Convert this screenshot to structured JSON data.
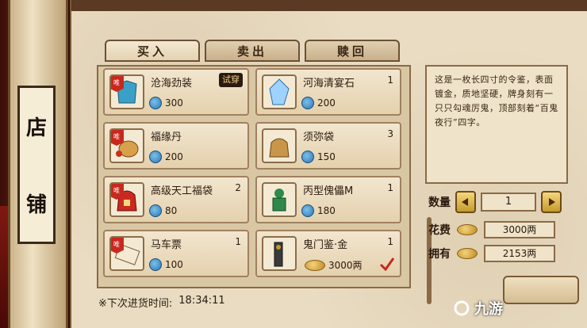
{
  "shop_sign": [
    "店",
    "铺"
  ],
  "tabs": [
    {
      "label": "买入",
      "active": true
    },
    {
      "label": "卖出",
      "active": false
    },
    {
      "label": "赎回",
      "active": false
    }
  ],
  "items": [
    {
      "name": "沧海劲装",
      "count": "",
      "price": "300",
      "currency": "blue-coin",
      "badge": "试穿",
      "ribbon": "唯"
    },
    {
      "name": "河海清宴石",
      "count": "1",
      "price": "200",
      "currency": "blue-coin",
      "badge": "",
      "ribbon": ""
    },
    {
      "name": "福缘丹",
      "count": "",
      "price": "200",
      "currency": "blue-coin",
      "badge": "",
      "ribbon": "唯"
    },
    {
      "name": "须弥袋",
      "count": "3",
      "price": "150",
      "currency": "blue-coin",
      "badge": "",
      "ribbon": ""
    },
    {
      "name": "高级天工福袋",
      "count": "2",
      "price": "80",
      "currency": "blue-coin",
      "badge": "",
      "ribbon": "唯"
    },
    {
      "name": "丙型傀儡M",
      "count": "1",
      "price": "180",
      "currency": "blue-coin",
      "badge": "",
      "ribbon": ""
    },
    {
      "name": "马车票",
      "count": "1",
      "price": "100",
      "currency": "blue-coin",
      "badge": "",
      "ribbon": "唯"
    },
    {
      "name": "鬼门鉴·金",
      "count": "1",
      "price": "3000两",
      "currency": "gold-ingot",
      "badge": "",
      "ribbon": "",
      "selected": true
    }
  ],
  "restock": {
    "label": "※下次进货时间:",
    "time": "18:34:11"
  },
  "description": "这是一枚长四寸的令鉴，表面镀金，质地坚硬，牌身刻有一只只勾魂厉鬼，顶部刻着“百鬼夜行”四字。",
  "quantity": {
    "label": "数量",
    "value": "1"
  },
  "cost": {
    "label": "花费",
    "value": "3000两"
  },
  "owned": {
    "label": "拥有",
    "value": "2153两"
  },
  "watermark": "九游",
  "colors": {
    "accent": "#c8281e",
    "parchment": "#e9dcc2",
    "gold": "#c59a2e"
  }
}
